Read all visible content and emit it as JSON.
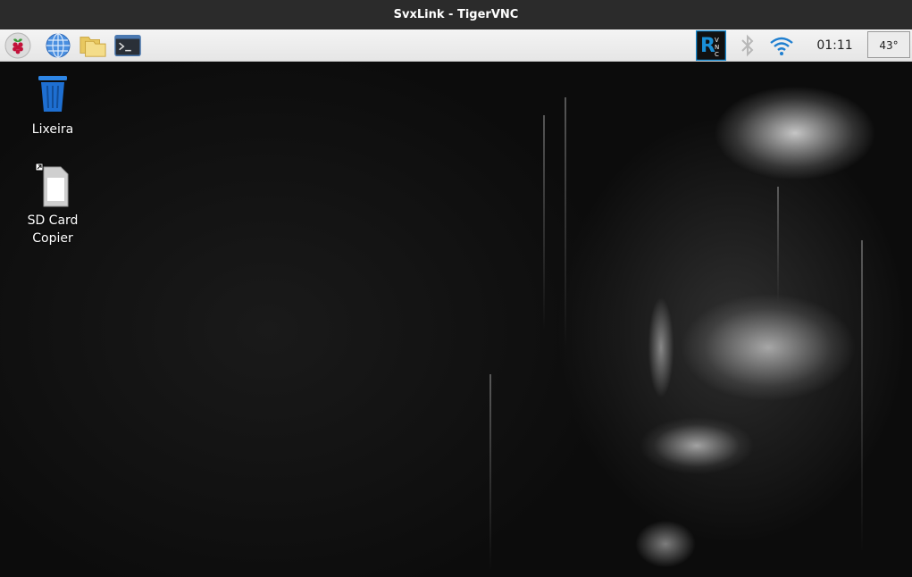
{
  "window": {
    "title": "SvxLink - TigerVNC"
  },
  "taskbar": {
    "clock": "01:11",
    "temperature": "43°",
    "launchers": [
      {
        "name": "raspberry-menu-icon"
      },
      {
        "name": "web-browser-icon"
      },
      {
        "name": "file-manager-icon"
      },
      {
        "name": "terminal-icon"
      }
    ],
    "tray": [
      {
        "name": "vnc-server-icon"
      },
      {
        "name": "bluetooth-icon"
      },
      {
        "name": "wifi-icon"
      }
    ]
  },
  "desktop": {
    "icons": [
      {
        "label": "Lixeira",
        "icon": "trash-icon"
      },
      {
        "label_line1": "SD Card",
        "label_line2": "Copier",
        "icon": "sd-card-icon"
      }
    ]
  },
  "colors": {
    "titlebar": "#2b2b2b",
    "taskbar": "#ececec",
    "vnc_accent": "#1a8fd6",
    "trash_blue": "#1e6fd1"
  }
}
